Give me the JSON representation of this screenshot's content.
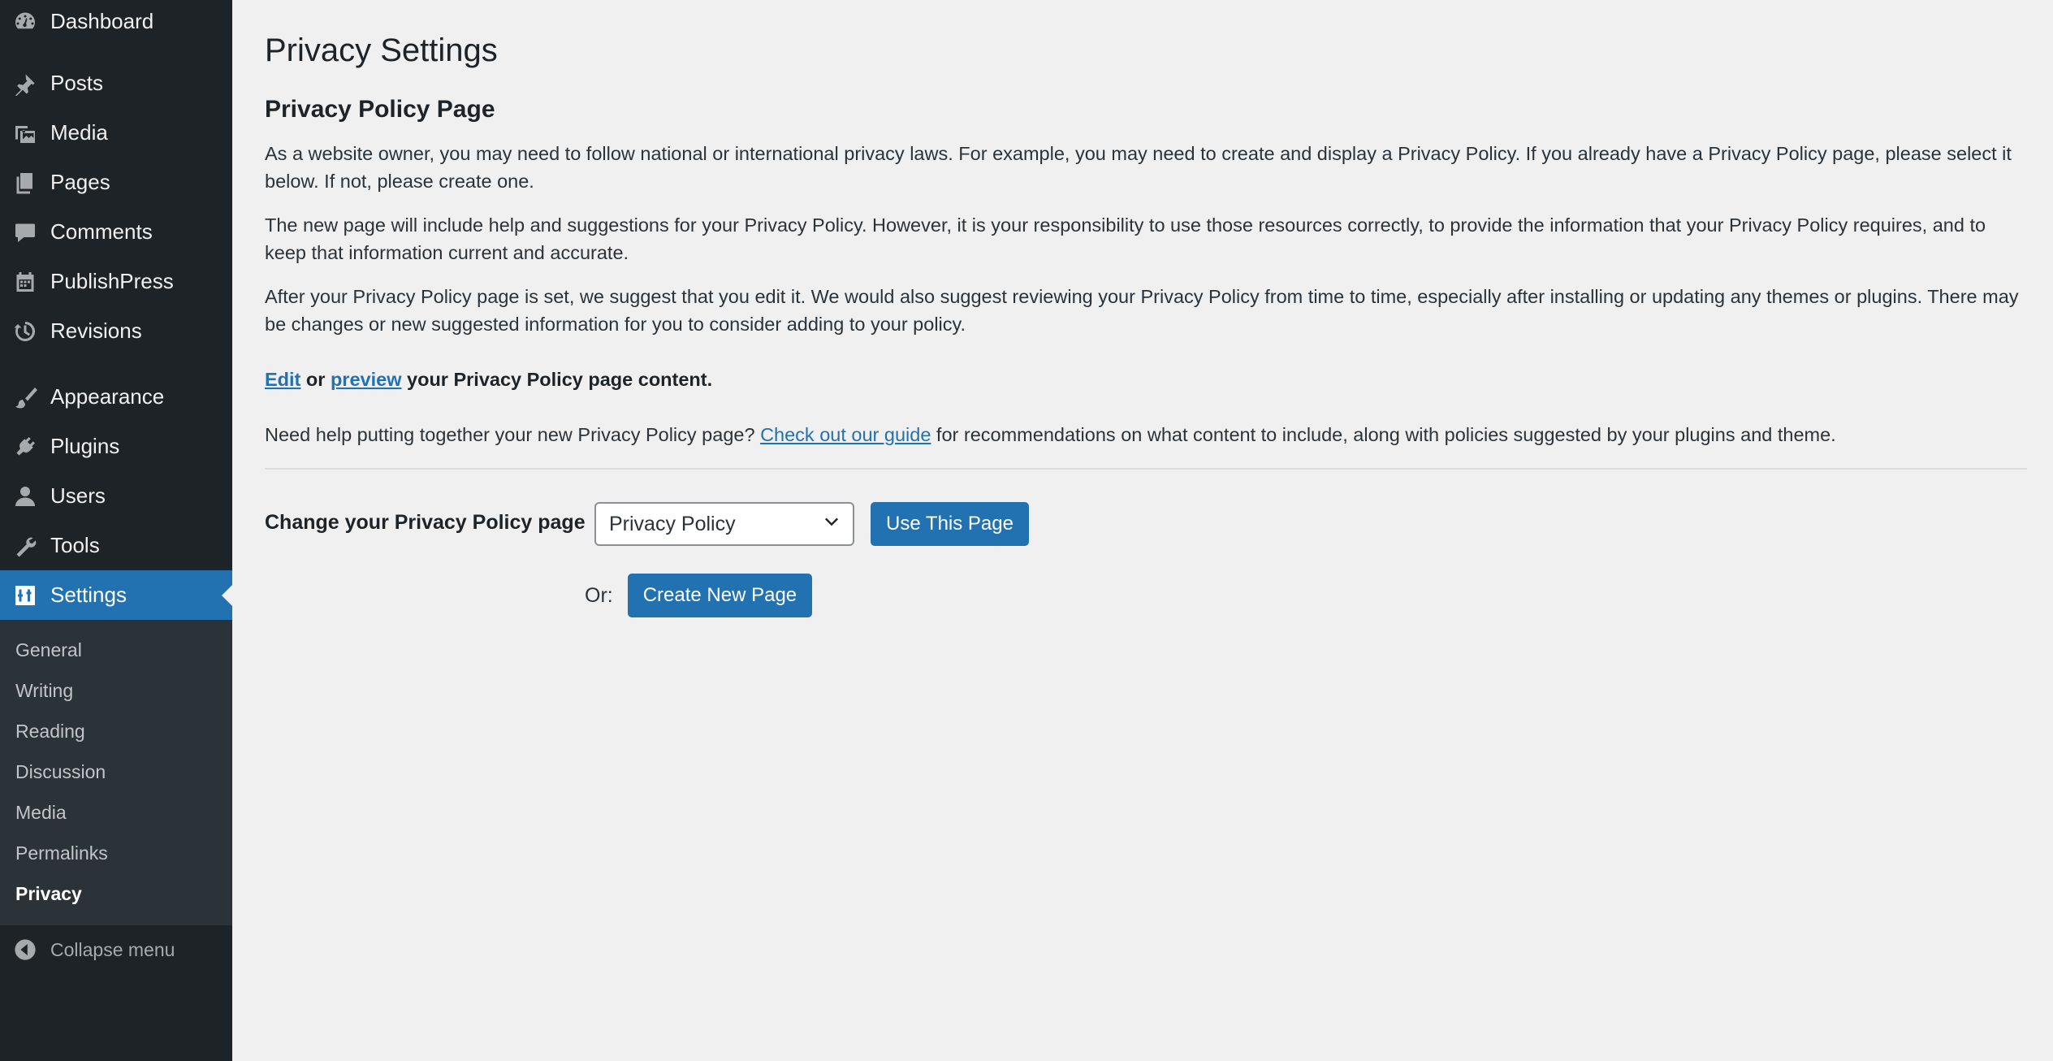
{
  "sidebar": {
    "items": [
      {
        "label": "Dashboard",
        "icon": "dashboard-icon"
      },
      {
        "label": "Posts",
        "icon": "pin-icon"
      },
      {
        "label": "Media",
        "icon": "media-icon"
      },
      {
        "label": "Pages",
        "icon": "pages-icon"
      },
      {
        "label": "Comments",
        "icon": "comment-icon"
      },
      {
        "label": "PublishPress",
        "icon": "calendar-icon"
      },
      {
        "label": "Revisions",
        "icon": "history-icon"
      },
      {
        "label": "Appearance",
        "icon": "brush-icon"
      },
      {
        "label": "Plugins",
        "icon": "plug-icon"
      },
      {
        "label": "Users",
        "icon": "user-icon"
      },
      {
        "label": "Tools",
        "icon": "wrench-icon"
      },
      {
        "label": "Settings",
        "icon": "settings-icon"
      }
    ],
    "submenu": [
      "General",
      "Writing",
      "Reading",
      "Discussion",
      "Media",
      "Permalinks",
      "Privacy"
    ],
    "collapse_label": "Collapse menu"
  },
  "main": {
    "title": "Privacy Settings",
    "section_title": "Privacy Policy Page",
    "paragraphs": [
      "As a website owner, you may need to follow national or international privacy laws. For example, you may need to create and display a Privacy Policy. If you already have a Privacy Policy page, please select it below. If not, please create one.",
      "The new page will include help and suggestions for your Privacy Policy. However, it is your responsibility to use those resources correctly, to provide the information that your Privacy Policy requires, and to keep that information current and accurate.",
      "After your Privacy Policy page is set, we suggest that you edit it. We would also suggest reviewing your Privacy Policy from time to time, especially after installing or updating any themes or plugins. There may be changes or new suggested information for you to consider adding to your policy."
    ],
    "edit_link": "Edit",
    "edit_or": " or ",
    "preview_link": "preview",
    "edit_suffix": " your Privacy Policy page content.",
    "help_prefix": "Need help putting together your new Privacy Policy page? ",
    "help_link": "Check out our guide",
    "help_suffix": " for recommendations on what content to include, along with policies suggested by your plugins and theme.",
    "form_label": "Change your Privacy Policy page",
    "select_value": "Privacy Policy",
    "use_button": "Use This Page",
    "or_label": "Or:",
    "create_button": "Create New Page"
  },
  "colors": {
    "sidebar_bg": "#1d2327",
    "accent": "#2271b1",
    "page_bg": "#f0f0f1"
  }
}
